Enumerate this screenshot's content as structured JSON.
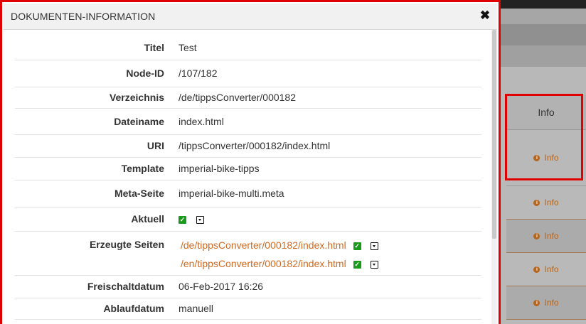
{
  "background": {
    "table_header": "Info",
    "rows": [
      {
        "label": "Info"
      },
      {
        "label": "Info"
      },
      {
        "label": "Info"
      },
      {
        "label": "Info"
      },
      {
        "label": "Info"
      }
    ],
    "colors": {
      "accent": "#b5651d",
      "highlight": "#e00000"
    }
  },
  "modal": {
    "title": "DOKUMENTEN-INFORMATION",
    "close_icon": "close-icon",
    "fields": {
      "titel": {
        "label": "Titel",
        "value": "Test"
      },
      "node_id": {
        "label": "Node-ID",
        "value": "/107/182"
      },
      "verzeichnis": {
        "label": "Verzeichnis",
        "value": "/de/tippsConverter/000182"
      },
      "dateiname": {
        "label": "Dateiname",
        "value": "index.html"
      },
      "uri": {
        "label": "URI",
        "value": "/tippsConverter/000182/index.html"
      },
      "template": {
        "label": "Template",
        "value": "imperial-bike-tipps"
      },
      "meta_seite": {
        "label": "Meta-Seite",
        "value": "imperial-bike-multi.meta"
      },
      "aktuell": {
        "label": "Aktuell",
        "checked": true
      },
      "erzeugte_seiten": {
        "label": "Erzeugte Seiten",
        "links": [
          "/de/tippsConverter/000182/index.html",
          "/en/tippsConverter/000182/index.html"
        ]
      },
      "freischaltdatum": {
        "label": "Freischaltdatum",
        "value": "06-Feb-2017 16:26"
      },
      "ablaufdatum": {
        "label": "Ablaufdatum",
        "value": "manuell"
      }
    }
  }
}
